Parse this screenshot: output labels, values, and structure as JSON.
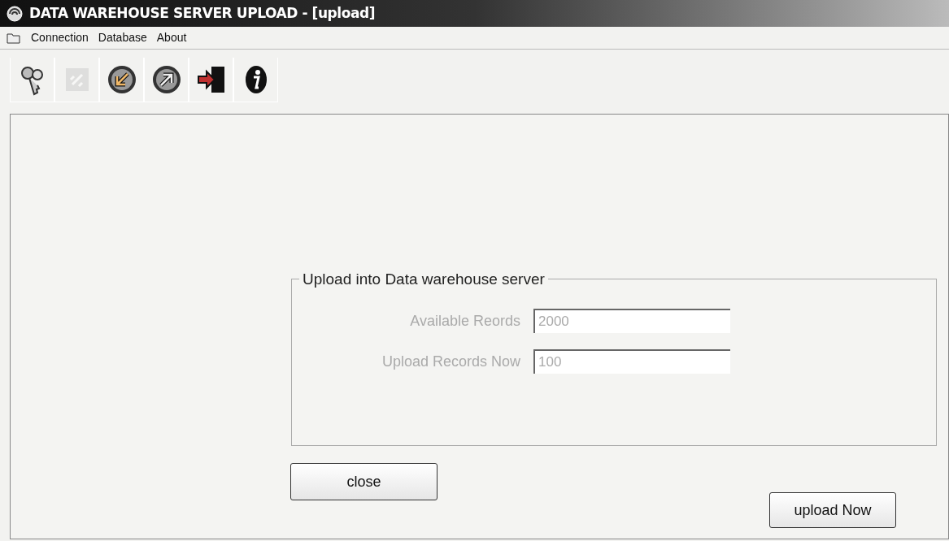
{
  "window": {
    "title": "DATA WAREHOUSE SERVER UPLOAD - [upload]"
  },
  "menu": [
    {
      "label": "Connection"
    },
    {
      "label": "Database"
    },
    {
      "label": "About"
    }
  ],
  "toolbar": [
    {
      "kind": "keys",
      "disabled": false
    },
    {
      "kind": "link",
      "disabled": true
    },
    {
      "kind": "download",
      "disabled": false
    },
    {
      "kind": "upload",
      "disabled": false
    },
    {
      "kind": "exit",
      "disabled": false
    },
    {
      "kind": "info",
      "disabled": false
    }
  ],
  "group": {
    "title": "Upload into Data warehouse server",
    "fields": [
      {
        "label": "Available Reords",
        "value": "2000",
        "disabled": true
      },
      {
        "label": "Upload Records Now",
        "value": "100",
        "disabled": true
      }
    ]
  },
  "buttons": [
    {
      "kind": "close",
      "label": "close"
    },
    {
      "kind": "upload",
      "label": "upload Now"
    }
  ]
}
